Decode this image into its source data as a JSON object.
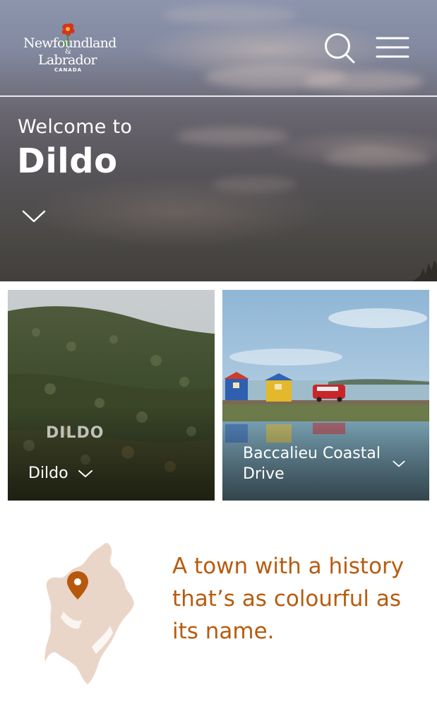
{
  "header": {
    "logo": {
      "line1": "Newfoundland",
      "line2": "Labrador",
      "amp": "&",
      "country": "CANADA"
    },
    "search_icon": "search-icon",
    "menu_icon": "hamburger-menu-icon"
  },
  "hero": {
    "welcome": "Welcome to",
    "title": "Dildo",
    "chevron_icon": "chevron-down-icon"
  },
  "cards": [
    {
      "label": "Dildo",
      "sign_text": "DILDO",
      "chevron_icon": "chevron-down-icon"
    },
    {
      "label": "Baccalieu Coastal Drive",
      "chevron_icon": "chevron-down-icon"
    }
  ],
  "intro": {
    "heading": "A town with a history that’s as colourful as its name.",
    "map_icon": "location-pin-icon"
  },
  "colors": {
    "accent": "#b75c0f",
    "pin": "#b6590f",
    "map_fill": "#ead6c8",
    "text_on_image": "#ffffff"
  }
}
